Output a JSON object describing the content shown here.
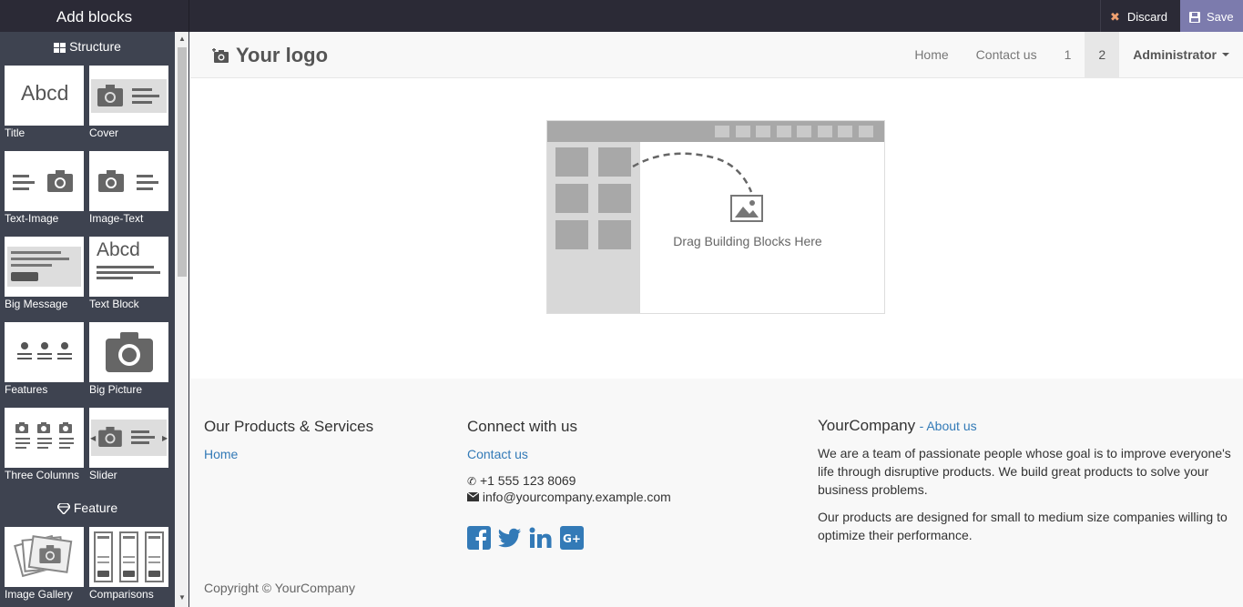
{
  "editor": {
    "title": "Add blocks",
    "discard": "Discard",
    "save": "Save"
  },
  "sidebar": {
    "categories": [
      "Structure",
      "Feature"
    ],
    "snippets": [
      {
        "label": "Title",
        "thumb": "Abcd"
      },
      {
        "label": "Cover"
      },
      {
        "label": "Text-Image"
      },
      {
        "label": "Image-Text"
      },
      {
        "label": "Big Message"
      },
      {
        "label": "Text Block",
        "thumb": "Abcd"
      },
      {
        "label": "Features"
      },
      {
        "label": "Big Picture"
      },
      {
        "label": "Three Columns"
      },
      {
        "label": "Slider"
      },
      {
        "label": "Image Gallery"
      },
      {
        "label": "Comparisons"
      }
    ]
  },
  "navbar": {
    "logo": "Your logo",
    "items": [
      "Home",
      "Contact us",
      "1",
      "2"
    ],
    "user": "Administrator"
  },
  "dropzone": {
    "text": "Drag Building Blocks Here"
  },
  "footer": {
    "products_title": "Our Products & Services",
    "products_link": "Home",
    "connect_title": "Connect with us",
    "connect_link": "Contact us",
    "phone": "+1 555 123 8069",
    "email": "info@yourcompany.example.com",
    "company_title": "YourCompany",
    "about_link": "- About us",
    "para1": "We are a team of passionate people whose goal is to improve everyone's life through disruptive products. We build great products to solve your business problems.",
    "para2": "Our products are designed for small to medium size companies willing to optimize their performance.",
    "copyright": "Copyright © YourCompany"
  },
  "colors": {
    "topbar": "#2b2a36",
    "sidebar": "#3e4350",
    "save_button": "#7c7bad",
    "link": "#337ab7",
    "social": "#337ab7"
  }
}
